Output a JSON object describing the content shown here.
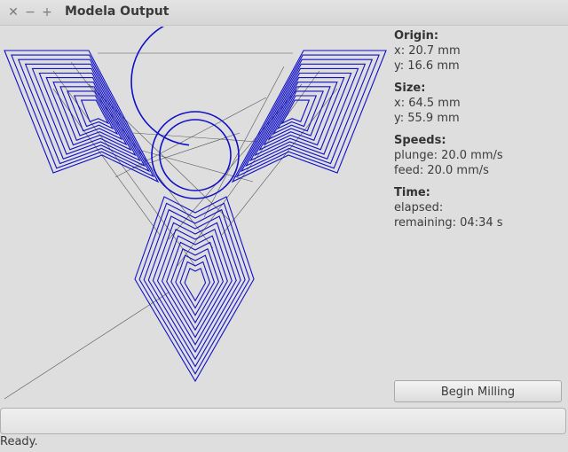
{
  "window": {
    "title": "Modela Output",
    "close_glyph": "✕",
    "minimize_glyph": "−",
    "maximize_glyph": "+"
  },
  "info": {
    "origin_label": "Origin:",
    "origin_x": "x: 20.7 mm",
    "origin_y": "y: 16.6 mm",
    "size_label": "Size:",
    "size_x": "x: 64.5 mm",
    "size_y": "y: 55.9 mm",
    "speeds_label": "Speeds:",
    "plunge": "plunge: 20.0 mm/s",
    "feed": "feed: 20.0 mm/s",
    "time_label": "Time:",
    "elapsed": "elapsed:",
    "remaining": "remaining: 04:34 s"
  },
  "actions": {
    "begin_label": "Begin Milling"
  },
  "progress": {
    "fraction": 0.0
  },
  "status": {
    "text": "Ready."
  },
  "colors": {
    "toolpath": "#1010c8",
    "travel": "#555555"
  }
}
